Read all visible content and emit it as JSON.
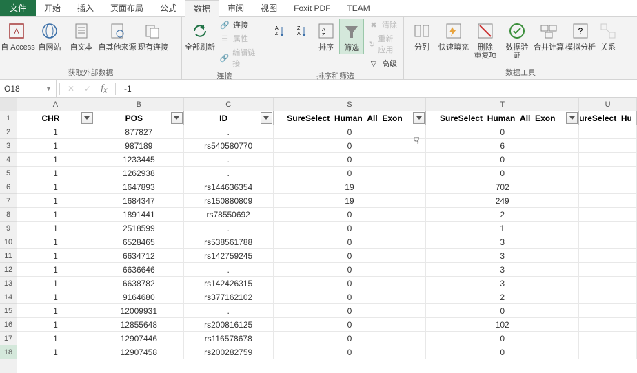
{
  "tabs": {
    "file": "文件",
    "items": [
      "开始",
      "插入",
      "页面布局",
      "公式",
      "数据",
      "审阅",
      "视图",
      "Foxit PDF",
      "TEAM"
    ],
    "active_index": 4
  },
  "ribbon": {
    "group1": {
      "label": "获取外部数据",
      "items": [
        "自 Access",
        "自网站",
        "自文本",
        "自其他来源",
        "现有连接"
      ]
    },
    "group2": {
      "label": "连接",
      "refresh": "全部刷新",
      "small": [
        "连接",
        "属性",
        "编辑链接"
      ]
    },
    "group3": {
      "label": "排序和筛选",
      "sort": "排序",
      "filter": "筛选",
      "small": [
        "清除",
        "重新应用",
        "高级"
      ]
    },
    "group4": {
      "label": "数据工具",
      "items": [
        "分列",
        "快速填充",
        "删除\n重复项",
        "数据验\n证",
        "合并计算",
        "模拟分析",
        "关系"
      ]
    }
  },
  "formula_bar": {
    "name_box": "O18",
    "formula": "-1"
  },
  "columns": [
    {
      "letter": "A",
      "width": "wA"
    },
    {
      "letter": "B",
      "width": "wB"
    },
    {
      "letter": "C",
      "width": "wC"
    },
    {
      "letter": "S",
      "width": "wS"
    },
    {
      "letter": "T",
      "width": "wT"
    },
    {
      "letter": "U",
      "width": "wU"
    }
  ],
  "header_row": {
    "number": "1",
    "cells": [
      "CHR",
      "POS",
      "ID",
      "SureSelect_Human_All_Exon",
      "SureSelect_Human_All_Exon",
      "SureSelect_Hu"
    ]
  },
  "rows": [
    {
      "n": "2",
      "c": [
        "1",
        "877827",
        ".",
        "0",
        "0",
        ""
      ]
    },
    {
      "n": "3",
      "c": [
        "1",
        "987189",
        "rs540580770",
        "0",
        "6",
        ""
      ]
    },
    {
      "n": "4",
      "c": [
        "1",
        "1233445",
        ".",
        "0",
        "0",
        ""
      ]
    },
    {
      "n": "5",
      "c": [
        "1",
        "1262938",
        ".",
        "0",
        "0",
        ""
      ]
    },
    {
      "n": "6",
      "c": [
        "1",
        "1647893",
        "rs144636354",
        "19",
        "702",
        ""
      ]
    },
    {
      "n": "7",
      "c": [
        "1",
        "1684347",
        "rs150880809",
        "19",
        "249",
        ""
      ]
    },
    {
      "n": "8",
      "c": [
        "1",
        "1891441",
        "rs78550692",
        "0",
        "2",
        ""
      ]
    },
    {
      "n": "9",
      "c": [
        "1",
        "2518599",
        ".",
        "0",
        "1",
        ""
      ]
    },
    {
      "n": "10",
      "c": [
        "1",
        "6528465",
        "rs538561788",
        "0",
        "3",
        ""
      ]
    },
    {
      "n": "11",
      "c": [
        "1",
        "6634712",
        "rs142759245",
        "0",
        "3",
        ""
      ]
    },
    {
      "n": "12",
      "c": [
        "1",
        "6636646",
        ".",
        "0",
        "3",
        ""
      ]
    },
    {
      "n": "13",
      "c": [
        "1",
        "6638782",
        "rs142426315",
        "0",
        "3",
        ""
      ]
    },
    {
      "n": "14",
      "c": [
        "1",
        "9164680",
        "rs377162102",
        "0",
        "2",
        ""
      ]
    },
    {
      "n": "15",
      "c": [
        "1",
        "12009931",
        ".",
        "0",
        "0",
        ""
      ]
    },
    {
      "n": "16",
      "c": [
        "1",
        "12855648",
        "rs200816125",
        "0",
        "102",
        ""
      ]
    },
    {
      "n": "17",
      "c": [
        "1",
        "12907446",
        "rs116578678",
        "0",
        "0",
        ""
      ]
    },
    {
      "n": "18",
      "c": [
        "1",
        "12907458",
        "rs200282759",
        "0",
        "0",
        ""
      ]
    }
  ],
  "selected_row": "18"
}
